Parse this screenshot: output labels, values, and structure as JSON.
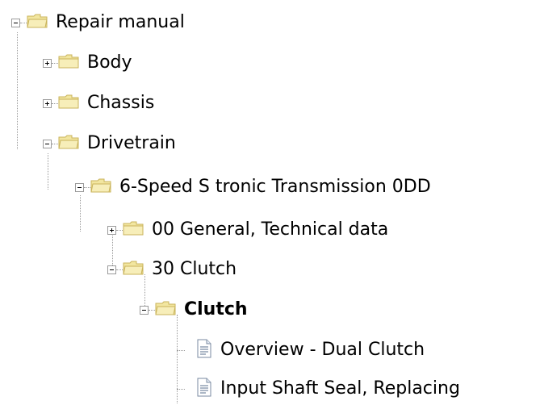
{
  "tree": {
    "root": {
      "label": "Repair manual",
      "state": "expanded"
    },
    "body": {
      "label": "Body",
      "state": "collapsed"
    },
    "chassis": {
      "label": "Chassis",
      "state": "collapsed"
    },
    "drivetrain": {
      "label": "Drivetrain",
      "state": "expanded"
    },
    "transmission": {
      "label": "6-Speed S tronic Transmission 0DD",
      "state": "expanded"
    },
    "general": {
      "label": "00 General, Technical data",
      "state": "collapsed"
    },
    "clutch30": {
      "label": "30 Clutch",
      "state": "expanded"
    },
    "clutch": {
      "label": "Clutch",
      "state": "expanded",
      "selected": true
    },
    "overview": {
      "label": "Overview - Dual Clutch",
      "type": "document"
    },
    "input_shaft": {
      "label": "Input Shaft Seal, Replacing",
      "type": "document"
    }
  },
  "icons": {
    "folder_closed": "folder-icon",
    "folder_open": "folder-open-icon",
    "document": "document-icon"
  },
  "colors": {
    "folder": "#f2e6a0",
    "folder_border": "#c9b35a",
    "tree_lines": "#9a9a9a"
  }
}
